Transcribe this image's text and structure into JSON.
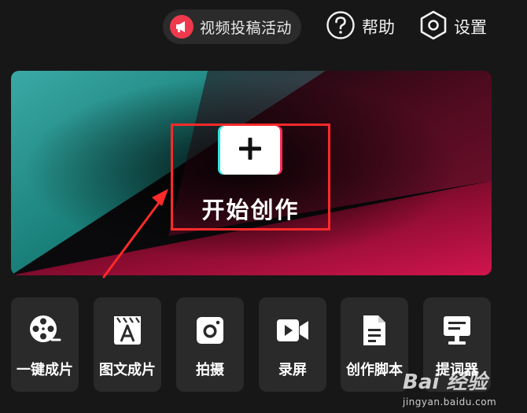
{
  "header": {
    "campaign_label": "视频投稿活动",
    "help_label": "帮助",
    "settings_label": "设置"
  },
  "hero": {
    "start_label": "开始创作"
  },
  "tools": [
    {
      "label": "一键成片",
      "icon": "film-reel-icon"
    },
    {
      "label": "图文成片",
      "icon": "text-image-icon"
    },
    {
      "label": "拍摄",
      "icon": "camera-icon"
    },
    {
      "label": "录屏",
      "icon": "screen-record-icon"
    },
    {
      "label": "创作脚本",
      "icon": "script-document-icon"
    },
    {
      "label": "提词器",
      "icon": "teleprompter-icon"
    }
  ],
  "watermark": {
    "brand": "Bai 经验",
    "url": "jingyan.baidu.com"
  },
  "colors": {
    "background": "#171717",
    "accent_red": "#f0394d",
    "highlight_box": "#ff2a2a",
    "teal": "#1aa89e",
    "magenta": "#b0123e"
  }
}
